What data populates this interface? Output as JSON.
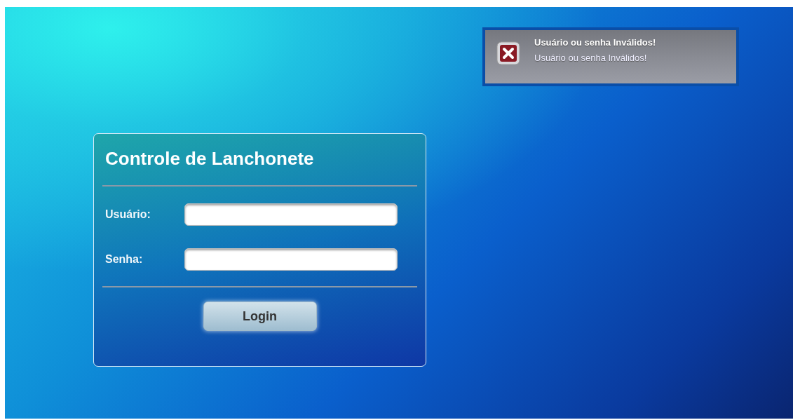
{
  "notification": {
    "kind": "error",
    "title": "Usuário ou senha Inválidos!",
    "message": "Usuário ou senha Inválidos!"
  },
  "login_panel": {
    "title": "Controle de Lanchonete",
    "fields": [
      {
        "label": "Usuário:"
      },
      {
        "label": "Senha:"
      }
    ],
    "button": "Login"
  }
}
